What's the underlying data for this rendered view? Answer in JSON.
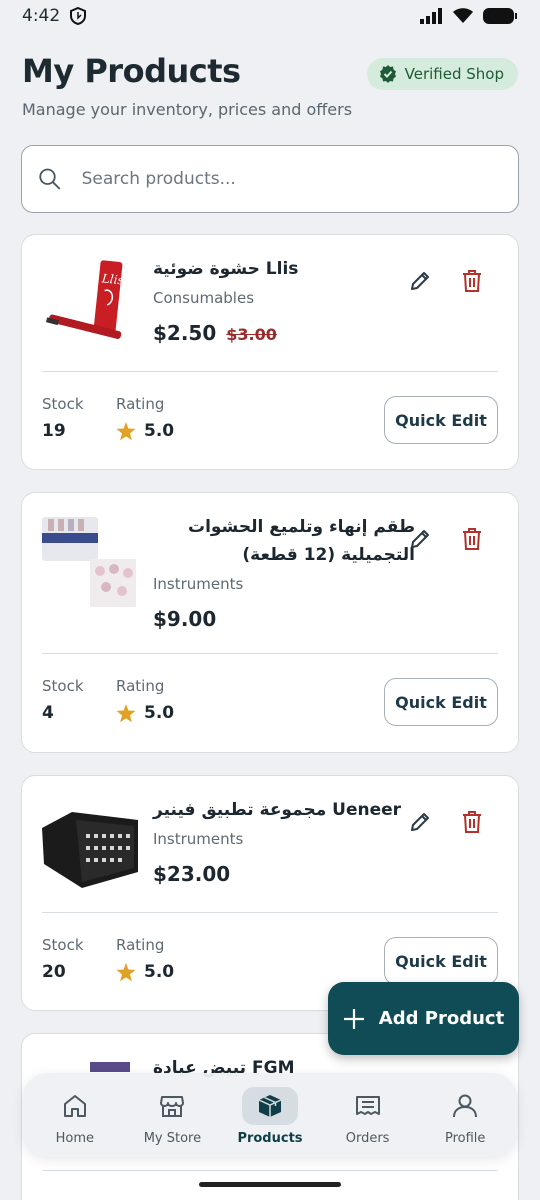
{
  "status": {
    "time": "4:42"
  },
  "header": {
    "title": "My Products",
    "subtitle": "Manage your inventory, prices and offers",
    "verified_label": "Verified Shop"
  },
  "search": {
    "placeholder": "Search products..."
  },
  "labels": {
    "stock": "Stock",
    "rating": "Rating",
    "quick_edit": "Quick Edit"
  },
  "products": [
    {
      "name": "حشوة ضوئية Llis",
      "category": "Consumables",
      "price": "$2.50",
      "old_price": "$3.00",
      "stock": "19",
      "rating": "5.0"
    },
    {
      "name_line1": "طقم إنهاء وتلميع الحشوات",
      "name_line2": "التجميلية (12 قطعة)",
      "category": "Instruments",
      "price": "$9.00",
      "stock": "4",
      "rating": "5.0"
    },
    {
      "name": "مجموعة تطبيق فينير Ueneer",
      "category": "Instruments",
      "price": "$23.00",
      "stock": "20",
      "rating": "5.0"
    },
    {
      "name": "تبيض عيادة FGM"
    }
  ],
  "fab": {
    "label": "Add Product"
  },
  "nav": {
    "home": "Home",
    "store": "My Store",
    "products": "Products",
    "orders": "Orders",
    "profile": "Profile"
  },
  "colors": {
    "accent": "#0f4c56",
    "verified_bg": "#d5ebdc",
    "danger": "#b3322b",
    "star": "#e0a125"
  }
}
